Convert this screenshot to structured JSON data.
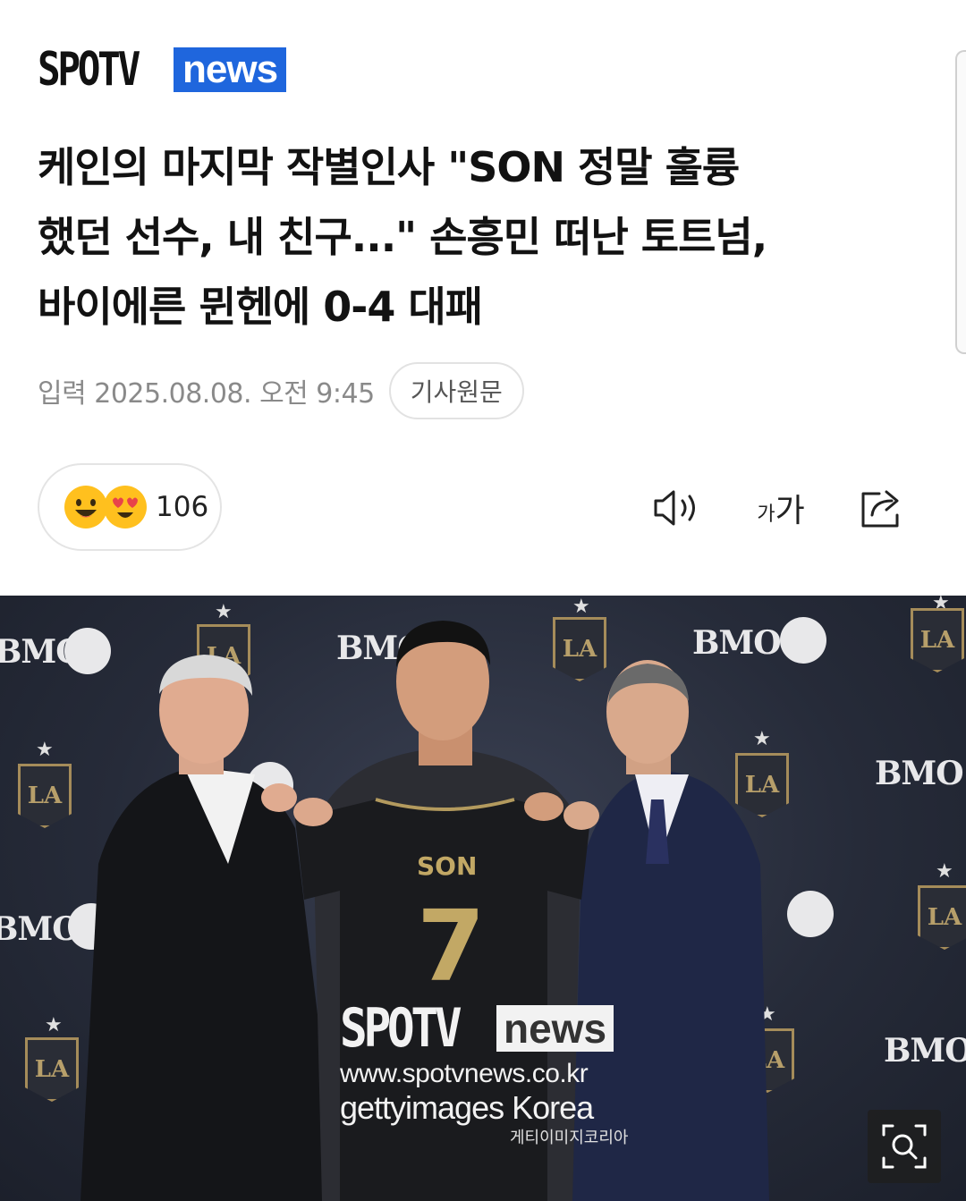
{
  "brand": {
    "part1": "SPOTV",
    "part2": "news",
    "accent": "#1f66dd"
  },
  "article": {
    "headline_lines": [
      "케인의 마지막 작별인사 \"SON 정말 훌륭",
      "했던 선수, 내 친구...\" 손흥민 떠난 토트넘,",
      "바이에른 뮌헨에 0-4 대패"
    ],
    "date": "입력 2025.08.08. 오전 9:45",
    "source_button": "기사원문"
  },
  "reactions": {
    "count": "106",
    "emojis": [
      "smile-emoji",
      "heart-eyes-emoji"
    ]
  },
  "toolbar": {
    "icons": [
      "speaker-icon",
      "font-size-icon",
      "share-icon"
    ],
    "font_size_small": "가",
    "font_size_large": "가"
  },
  "photo": {
    "backdrop_brand": "BMO",
    "jersey_name": "SON",
    "jersey_number": "7",
    "watermark": {
      "logo_part1": "SPOTV",
      "logo_part2": "news",
      "url": "www.spotvnews.co.kr",
      "getty": "gettyimages Korea",
      "getty_korean": "게티이미지코리아"
    },
    "zoom_icon": "zoom-icon"
  }
}
